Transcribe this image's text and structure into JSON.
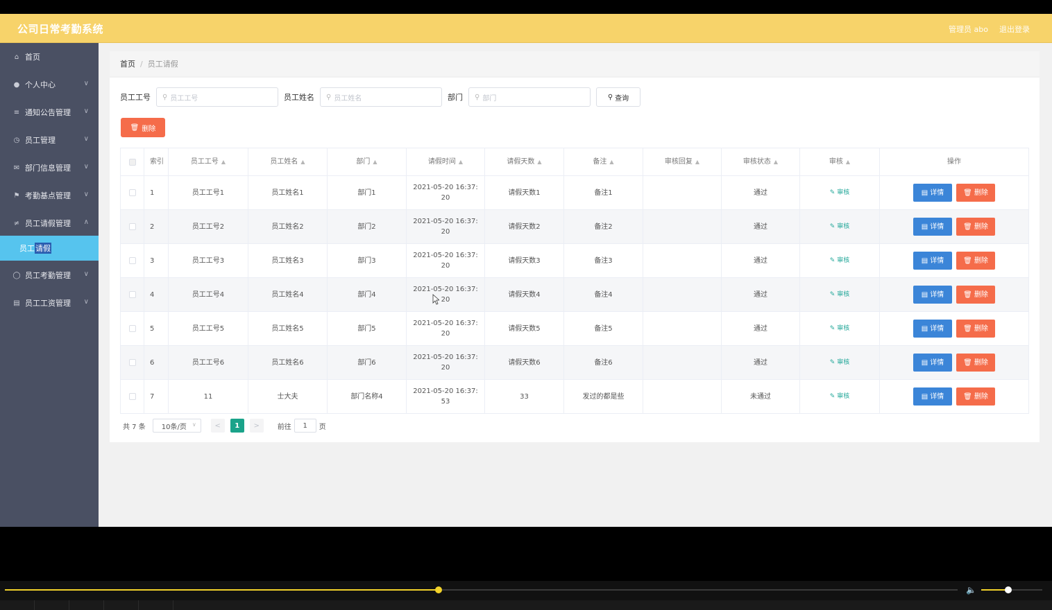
{
  "app": {
    "title": "公司日常考勤系统",
    "user_label": "管理员 abo",
    "logout": "退出登录",
    "accent": "#f7d36a"
  },
  "sidebar": {
    "items": [
      {
        "label": "首页",
        "icon": "home-icon",
        "expandable": false
      },
      {
        "label": "个人中心",
        "icon": "user-icon",
        "expandable": true
      },
      {
        "label": "通知公告管理",
        "icon": "list-icon",
        "expandable": true
      },
      {
        "label": "员工管理",
        "icon": "clock-icon",
        "expandable": true
      },
      {
        "label": "部门信息管理",
        "icon": "mail-icon",
        "expandable": true
      },
      {
        "label": "考勤基点管理",
        "icon": "flag-icon",
        "expandable": true
      },
      {
        "label": "员工请假管理",
        "icon": "sliders-icon",
        "expandable": true,
        "expanded": true
      },
      {
        "label": "员工考勤管理",
        "icon": "circle-icon",
        "expandable": true
      },
      {
        "label": "员工工资管理",
        "icon": "card-icon",
        "expandable": true
      }
    ],
    "active_sub": {
      "prefix": "员工",
      "selected": "请假"
    }
  },
  "breadcrumb": {
    "home": "首页",
    "separator": "/",
    "current": "员工请假"
  },
  "search": {
    "fields": [
      {
        "label": "员工工号",
        "placeholder": "员工工号"
      },
      {
        "label": "员工姓名",
        "placeholder": "员工姓名"
      },
      {
        "label": "部门",
        "placeholder": "部门"
      }
    ],
    "query_label": "查询"
  },
  "toolbar": {
    "delete_label": "删除"
  },
  "table": {
    "headers": [
      "",
      "索引",
      "员工工号",
      "员工姓名",
      "部门",
      "请假时间",
      "请假天数",
      "备注",
      "审核回复",
      "审核状态",
      "审核",
      "操作"
    ],
    "sortable": [
      false,
      false,
      true,
      true,
      true,
      true,
      true,
      true,
      true,
      true,
      true,
      false
    ],
    "audit_label": "审核",
    "detail_label": "详情",
    "delete_label": "删除",
    "rows": [
      {
        "index": "1",
        "emp_no": "员工工号1",
        "emp_name": "员工姓名1",
        "dept": "部门1",
        "time_a": "2021-05-20 16:37:",
        "time_b": "20",
        "days": "请假天数1",
        "note": "备注1",
        "reply": "",
        "status": "通过"
      },
      {
        "index": "2",
        "emp_no": "员工工号2",
        "emp_name": "员工姓名2",
        "dept": "部门2",
        "time_a": "2021-05-20 16:37:",
        "time_b": "20",
        "days": "请假天数2",
        "note": "备注2",
        "reply": "",
        "status": "通过"
      },
      {
        "index": "3",
        "emp_no": "员工工号3",
        "emp_name": "员工姓名3",
        "dept": "部门3",
        "time_a": "2021-05-20 16:37:",
        "time_b": "20",
        "days": "请假天数3",
        "note": "备注3",
        "reply": "",
        "status": "通过"
      },
      {
        "index": "4",
        "emp_no": "员工工号4",
        "emp_name": "员工姓名4",
        "dept": "部门4",
        "time_a": "2021-05-20 16:37:",
        "time_b": "20",
        "days": "请假天数4",
        "note": "备注4",
        "reply": "",
        "status": "通过"
      },
      {
        "index": "5",
        "emp_no": "员工工号5",
        "emp_name": "员工姓名5",
        "dept": "部门5",
        "time_a": "2021-05-20 16:37:",
        "time_b": "20",
        "days": "请假天数5",
        "note": "备注5",
        "reply": "",
        "status": "通过"
      },
      {
        "index": "6",
        "emp_no": "员工工号6",
        "emp_name": "员工姓名6",
        "dept": "部门6",
        "time_a": "2021-05-20 16:37:",
        "time_b": "20",
        "days": "请假天数6",
        "note": "备注6",
        "reply": "",
        "status": "通过"
      },
      {
        "index": "7",
        "emp_no": "11",
        "emp_name": "士大夫",
        "dept": "部门名称4",
        "time_a": "2021-05-20 16:37:",
        "time_b": "53",
        "days": "33",
        "note": "发过的都是些",
        "reply": "",
        "status": "未通过"
      }
    ]
  },
  "pagination": {
    "total": "共 7 条",
    "page_size": "10条/页",
    "prev": "<",
    "current_page": "1",
    "next": ">",
    "goto_label": "前往",
    "goto_value": "1",
    "page_unit": "页"
  },
  "player": {
    "progress": 0.455,
    "volume": 0.44,
    "accent": "#f2d22a"
  }
}
